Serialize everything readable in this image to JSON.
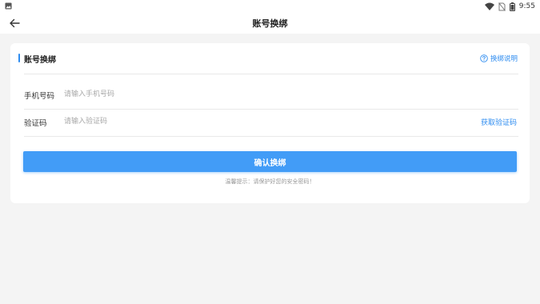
{
  "status_bar": {
    "time": "9:55"
  },
  "app_bar": {
    "title": "账号换绑"
  },
  "card": {
    "title": "账号换绑",
    "help_label": "换绑说明",
    "phone": {
      "label": "手机号码",
      "placeholder": "请输入手机号码",
      "value": ""
    },
    "code": {
      "label": "验证码",
      "placeholder": "请输入验证码",
      "value": "",
      "get_code_label": "获取验证码"
    },
    "confirm_label": "确认换绑",
    "tip": "温馨提示：请保护好您的安全密码！"
  },
  "colors": {
    "accent": "#2e8cf0",
    "button": "#429cf7",
    "background": "#f4f4f4"
  }
}
